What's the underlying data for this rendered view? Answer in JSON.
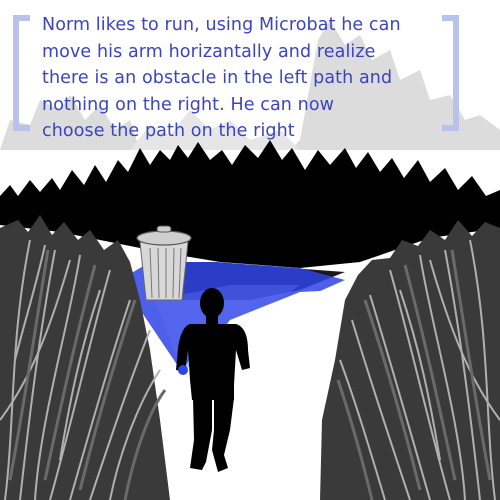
{
  "caption": {
    "lines": [
      "Norm likes to run, using Microbat he can",
      "move his arm horizantally and realize",
      "there is an obstacle in the left path and",
      "nothing on the right. He can now",
      "choose the path on the right"
    ]
  },
  "colors": {
    "caption_text": "#3a44c2",
    "bracket": "#b8c2ea",
    "sonar_beam": "#2f44e6",
    "silhouette": "#000000",
    "grass_light": "#a0a0a0",
    "grass_dark": "#3a3a3a",
    "background_trees": "#d8d8d8"
  },
  "scene": {
    "runner": "runner-silhouette",
    "obstacle": "trash-can-icon",
    "device": "microbat-device-icon"
  }
}
